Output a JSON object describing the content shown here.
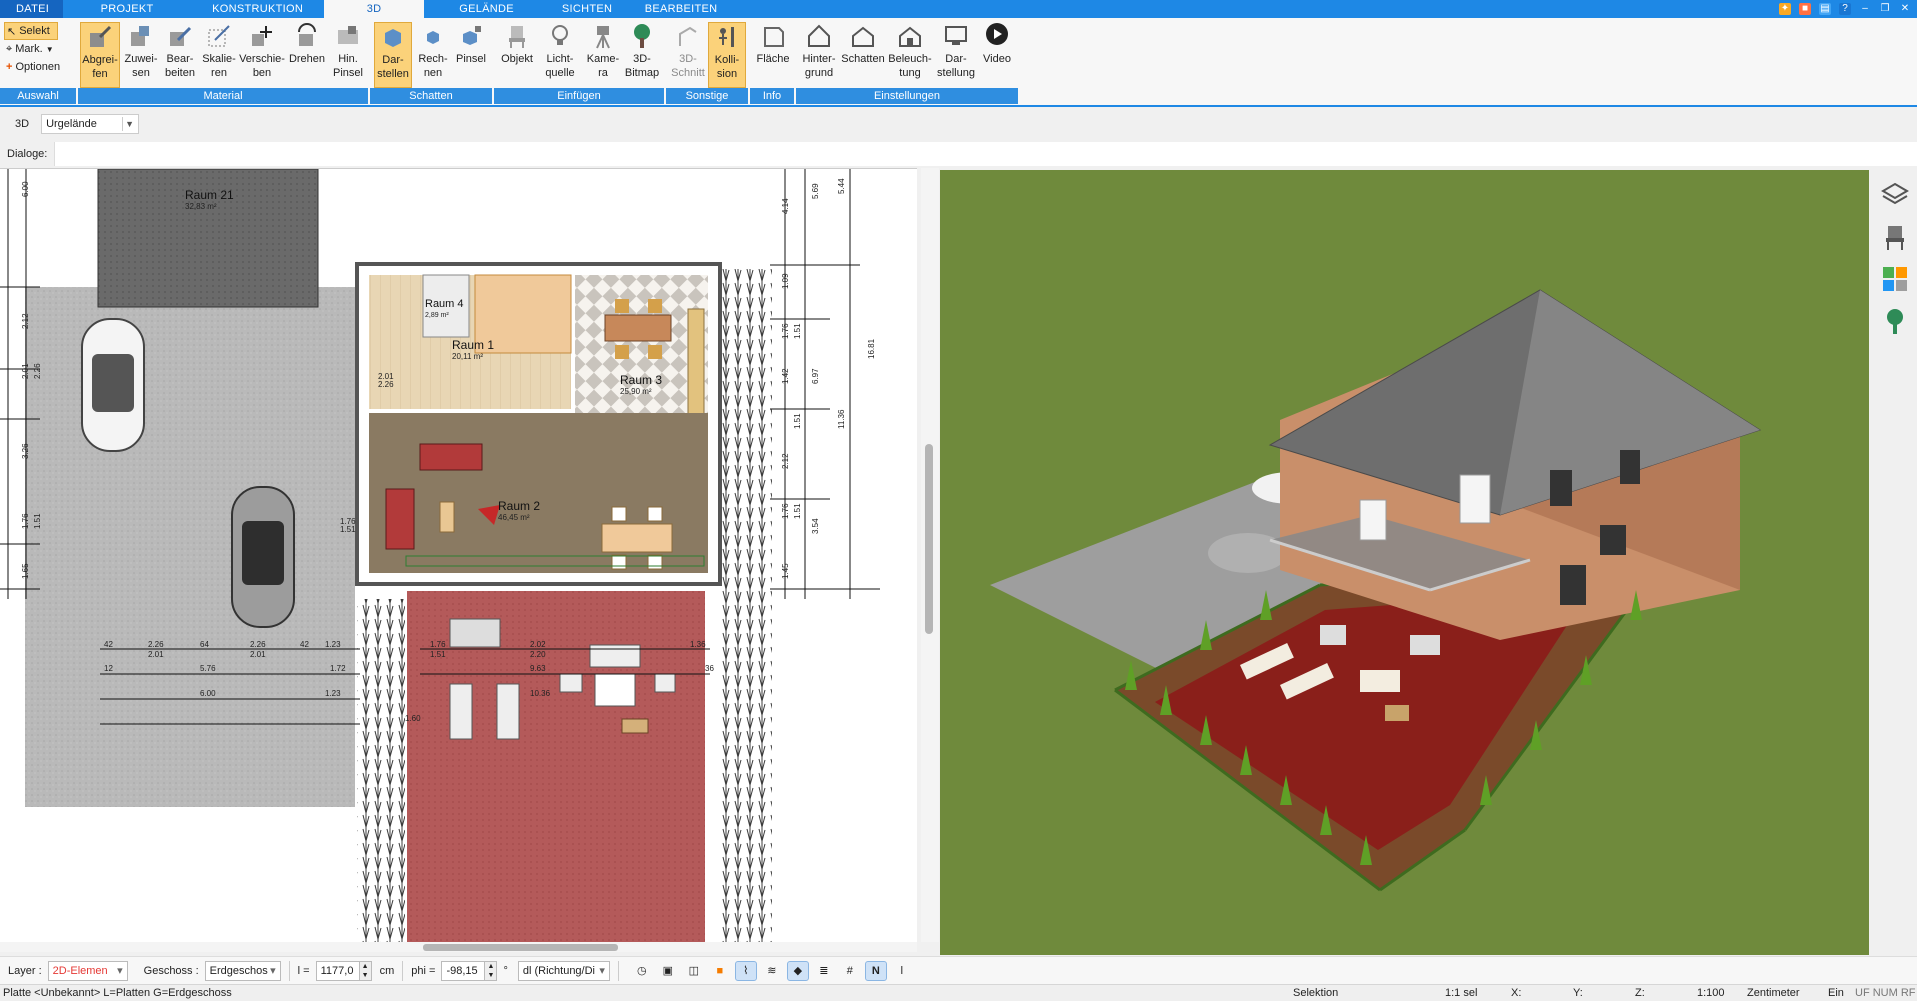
{
  "menu": {
    "tabs": [
      "DATEI",
      "PROJEKT",
      "KONSTRUKTION",
      "3D",
      "GELÄNDE",
      "SICHTEN",
      "BEARBEITEN"
    ],
    "active": "3D"
  },
  "ribbon": {
    "selection": {
      "select_label": "Selekt",
      "mark_label": "Mark.",
      "options_label": "Optionen"
    },
    "tools": {
      "pick": "Abgrei-\nfen",
      "assign": "Zuwei-\nsen",
      "edit": "Bear-\nbeiten",
      "scale": "Skalie-\nren",
      "move": "Verschie-\nben",
      "rotate": "Drehen",
      "brush": "Hin.\nPinsel",
      "represent": "Dar-\nstellen",
      "calculate": "Rech-\nnen",
      "pinsel": "Pinsel",
      "object": "Objekt",
      "light": "Licht-\nquelle",
      "camera": "Kame-\nra",
      "bitmap": "3D-\nBitmap",
      "section": "3D-\nSchnitt",
      "collision": "Kolli-\nsion",
      "area": "Fläche",
      "background": "Hinter-\ngrund",
      "shadow": "Schatten",
      "lighting": "Beleuch-\ntung",
      "display": "Dar-\nstellung",
      "video": "Video"
    },
    "groups": {
      "auswahl": "Auswahl",
      "material": "Material",
      "schatten": "Schatten",
      "einfuegen": "Einfügen",
      "sonstige": "Sonstige",
      "info": "Info",
      "einstellungen": "Einstellungen"
    }
  },
  "view_row": {
    "label": "3D",
    "terrain": "Urgelände"
  },
  "dialog_row": {
    "label": "Dialoge:"
  },
  "plan": {
    "rooms": [
      {
        "name": "Raum 21",
        "area": "32,83 m²"
      },
      {
        "name": "Raum 4",
        "area": "2,89 m²"
      },
      {
        "name": "Raum 1",
        "area": "20,11 m²"
      },
      {
        "name": "Raum 3",
        "area": "25,90 m²"
      },
      {
        "name": "Raum 2",
        "area": "46,45 m²"
      }
    ],
    "dims_left": [
      "6.00",
      "2.12",
      "2.01",
      "2.26",
      "3.26",
      "1.76",
      "1.51",
      "1.65"
    ],
    "dims_right": [
      "4.14",
      "5.69",
      "5.44",
      "1.09",
      "1.76",
      "1.51",
      "1.42",
      "6.97",
      "16.81",
      "11.36",
      "1.51",
      "2.12",
      "1.76",
      "1.51",
      "3.54",
      "1.45"
    ],
    "dims_bottom_1": [
      "42",
      "2.26",
      "64",
      "2.26",
      "42",
      "1.23",
      "1.76",
      "2.02",
      "1.36"
    ],
    "dims_bottom_2": [
      "2.01",
      "2.01",
      "1.51",
      "2.20"
    ],
    "dims_bottom_3": [
      "12",
      "5.76",
      "1.72",
      "9.63",
      "36"
    ],
    "dims_bottom_4": [
      "6.00",
      "1.23",
      "10.36"
    ],
    "dims_bottom_5": [
      "1.60"
    ],
    "small_labels": [
      "2.01",
      "2.26",
      "1.76",
      "1.51",
      "1.76",
      "1.51"
    ]
  },
  "editbar": {
    "layer_label": "Layer :",
    "layer_value": "2D-Elemen",
    "floor_label": "Geschoss :",
    "floor_value": "Erdgeschos",
    "l_label": "l =",
    "l_value": "1177,0",
    "l_unit": "cm",
    "phi_label": "phi =",
    "phi_value": "-98,15",
    "phi_unit": "°",
    "dir_value": "dl (Richtung/Di"
  },
  "status": {
    "left": "Platte <Unbekannt> L=Platten G=Erdgeschoss",
    "mode": "Selektion",
    "sel": "1:1 sel",
    "x": "X:",
    "y": "Y:",
    "z": "Z:",
    "scale": "1:100",
    "unit": "Zentimeter",
    "on": "Ein",
    "flags": "UF NUM RF"
  },
  "colors": {
    "accent": "#1e88e5",
    "highlight": "#fbd27a",
    "grass": "#6f8a3c",
    "terrace": "#9a2a24"
  }
}
